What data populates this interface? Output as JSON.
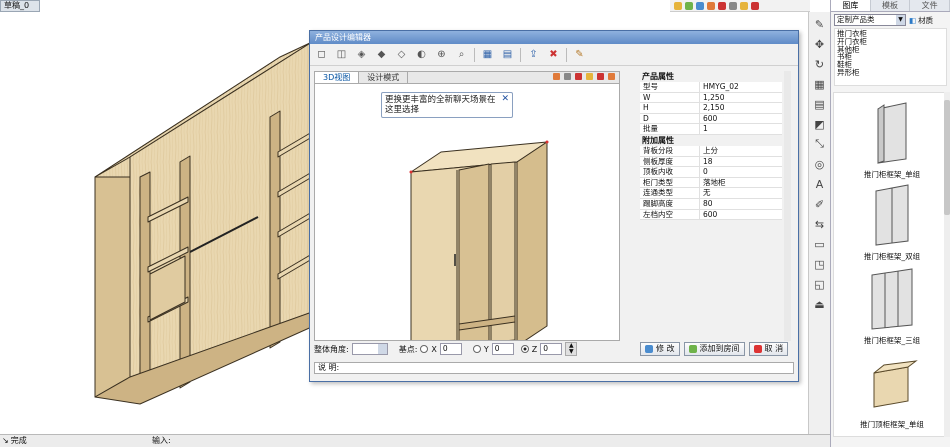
{
  "document": {
    "tab_label": "草稿_0"
  },
  "colors": {
    "wood": "#e9d7b0",
    "wood_dark": "#cdb384",
    "edge": "#3a3020",
    "accent": "#2b5fa8",
    "title_bar": "#5f8bc7"
  },
  "top_toolbar": {
    "icons": [
      "add-icon",
      "settings-icon",
      "tool-icon",
      "tool-icon",
      "tool-icon"
    ]
  },
  "right_toolbar": {
    "icons": [
      "brush-icon",
      "move-icon",
      "rotate-icon",
      "grid-icon",
      "grid-icon",
      "edit-icon",
      "scale-icon",
      "circle-icon",
      "text-icon",
      "annotate-icon",
      "align-icon",
      "measure-icon",
      "panel-icon",
      "panel-icon",
      "panel-icon"
    ]
  },
  "library": {
    "tabs": [
      "图库",
      "模板",
      "文件"
    ],
    "category_select": "定制产品类",
    "material_label": "材质",
    "categories": [
      "推门衣柜",
      "开门衣柜",
      "其他柜",
      "书柜",
      "鞋柜",
      "异形柜"
    ],
    "items": [
      {
        "label": "推门柜框架_单组"
      },
      {
        "label": "推门柜框架_双组"
      },
      {
        "label": "推门柜框架_三组"
      },
      {
        "label": "推门顶柜框架_单组"
      }
    ]
  },
  "status": {
    "left_text": "完成",
    "input_label": "输入:"
  },
  "dialog": {
    "title": "产品设计编辑器",
    "toolbar_icons": [
      "view-front-icon",
      "view-side-icon",
      "view-3d-icon",
      "view-top-icon",
      "view-back-icon",
      "rotate-icon",
      "zoom-in-icon",
      "zoom-icon",
      "grid-icon",
      "list-icon",
      "export-icon",
      "delete-icon",
      "brush-icon"
    ],
    "view_tabs": [
      "3D视图",
      "设计模式"
    ],
    "tooltip": "更换更丰富的全新聊天场景在这里选择",
    "properties": {
      "product_heading": "产品属性",
      "product_rows": [
        {
          "key": "型号",
          "value": "HMYG_02"
        },
        {
          "key": "W",
          "value": "1,250"
        },
        {
          "key": "H",
          "value": "2,150"
        },
        {
          "key": "D",
          "value": "600"
        },
        {
          "key": "批量",
          "value": "1"
        }
      ],
      "extra_heading": "附加属性",
      "extra_rows": [
        {
          "key": "背板分段",
          "value": "上分"
        },
        {
          "key": "侧板厚度",
          "value": "18"
        },
        {
          "key": "顶板内收",
          "value": "0"
        },
        {
          "key": "柜门类型",
          "value": "落地柜"
        },
        {
          "key": "连通类型",
          "value": "无"
        },
        {
          "key": "踢脚高度",
          "value": "80"
        },
        {
          "key": "左档内空",
          "value": "600"
        }
      ]
    },
    "controls": {
      "angle_label": "整体角度:",
      "base_label": "基点:",
      "x_label": "X",
      "x_value": "0",
      "y_label": "Y",
      "y_value": "0",
      "z_label": "Z",
      "z_value": "0"
    },
    "buttons": {
      "modify": "修 改",
      "add": "添加到房间",
      "cancel": "取 消"
    },
    "description_label": "说 明:"
  }
}
